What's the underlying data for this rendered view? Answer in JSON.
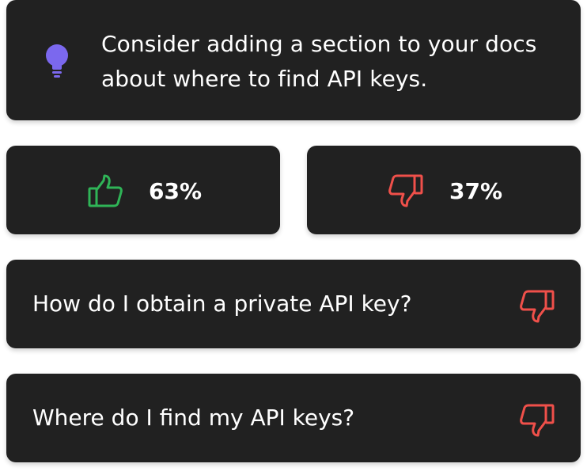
{
  "suggestion": {
    "icon": "lightbulb-icon",
    "icon_color": "#7B68EE",
    "text": "Consider adding a section to your docs about where to find API keys."
  },
  "votes": {
    "up": {
      "icon": "thumbs-up-icon",
      "color": "#2FB457",
      "percent": "63%"
    },
    "down": {
      "icon": "thumbs-down-icon",
      "color": "#F0504A",
      "percent": "37%"
    }
  },
  "questions": [
    {
      "text": "How do I obtain a private API key?",
      "icon": "thumbs-down-icon"
    },
    {
      "text": "Where do I find my API keys?",
      "icon": "thumbs-down-icon"
    }
  ]
}
